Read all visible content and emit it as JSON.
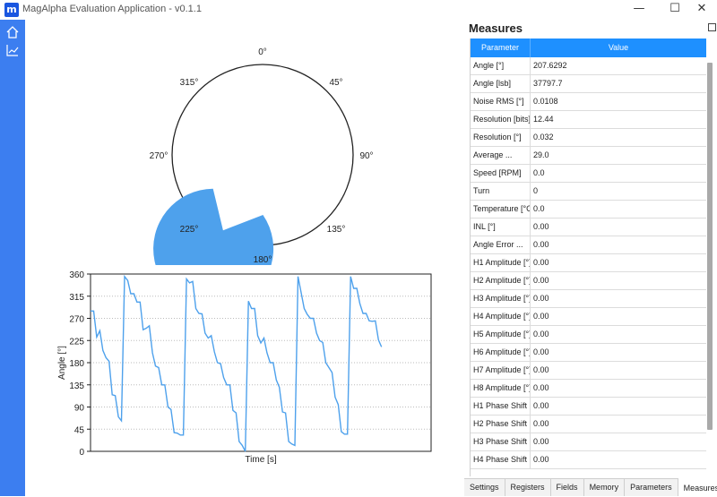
{
  "window": {
    "title": "MagAlpha Evaluation Application - v0.1.1",
    "icon_letter": "m",
    "minimize": "—",
    "maximize": "☐",
    "close": "✕"
  },
  "sidebar": {
    "items": [
      {
        "icon": "home-icon"
      },
      {
        "icon": "chart-icon"
      }
    ],
    "color": "#3c7ef0"
  },
  "gauge": {
    "value_text": "207.63°",
    "angle_deg": 207.63,
    "labels": [
      "0°",
      "45°",
      "90°",
      "135°",
      "180°",
      "225°",
      "270°",
      "315°"
    ],
    "accent": "#4ea1ec"
  },
  "chart_data": {
    "type": "line",
    "xlabel": "Time [s]",
    "ylabel": "Angle [°]",
    "ylim": [
      0,
      360
    ],
    "yticks": [
      0,
      45,
      90,
      135,
      180,
      225,
      270,
      315,
      360
    ],
    "grid": "horizontal dotted",
    "color": "#4ea1ec",
    "x": [
      0,
      1,
      2,
      3,
      4,
      5,
      6,
      7,
      8,
      9,
      10,
      11,
      12,
      13,
      14,
      15,
      16,
      17,
      18,
      19,
      20,
      21,
      22,
      23,
      24,
      25,
      26,
      27,
      28,
      29,
      30,
      31,
      32,
      33,
      34,
      35,
      36,
      37,
      38,
      39,
      40,
      41,
      42,
      43,
      44,
      45,
      46,
      47,
      48,
      49,
      50,
      51,
      52,
      53,
      54,
      55,
      56,
      57,
      58,
      59,
      60,
      61,
      62,
      63,
      64,
      65,
      66,
      67,
      68,
      69,
      70,
      71,
      72,
      73,
      74,
      75,
      76,
      77,
      78,
      79,
      80,
      81,
      82,
      83,
      84,
      85,
      86,
      87,
      88,
      89,
      90,
      91,
      92,
      93,
      94,
      95,
      96,
      97,
      98,
      99,
      100,
      101,
      102,
      103,
      104,
      105,
      106,
      107,
      108,
      109,
      110
    ],
    "y": [
      285,
      285,
      232,
      245,
      205,
      190,
      183,
      115,
      113,
      70,
      62,
      355,
      347,
      320,
      320,
      303,
      303,
      247,
      250,
      255,
      200,
      173,
      170,
      135,
      135,
      90,
      85,
      38,
      37,
      33,
      33,
      350,
      342,
      345,
      290,
      280,
      279,
      240,
      230,
      235,
      202,
      180,
      178,
      150,
      135,
      135,
      83,
      78,
      20,
      12,
      0,
      305,
      290,
      290,
      235,
      220,
      230,
      200,
      180,
      180,
      145,
      130,
      80,
      78,
      20,
      15,
      12,
      355,
      323,
      290,
      278,
      270,
      270,
      240,
      225,
      221,
      180,
      170,
      160,
      110,
      95,
      40,
      35,
      35,
      355,
      331,
      331,
      300,
      280,
      280,
      265,
      264,
      265,
      226,
      212
    ]
  },
  "measures": {
    "title": "Measures",
    "headers": [
      "Parameter",
      "Value"
    ],
    "rows": [
      {
        "param": "Angle [°]",
        "value": "207.6292"
      },
      {
        "param": "Angle [lsb]",
        "value": "37797.7"
      },
      {
        "param": "Noise RMS [°]",
        "value": "0.0108"
      },
      {
        "param": "Resolution [bits]",
        "value": "12.44"
      },
      {
        "param": "Resolution [°]",
        "value": "0.032"
      },
      {
        "param": "Average ...",
        "value": "29.0"
      },
      {
        "param": "Speed [RPM]",
        "value": "0.0"
      },
      {
        "param": "Turn",
        "value": "0"
      },
      {
        "param": "Temperature [°C]",
        "value": "0.0"
      },
      {
        "param": "INL [°]",
        "value": "0.00"
      },
      {
        "param": "Angle Error ...",
        "value": "0.00"
      },
      {
        "param": "H1 Amplitude [°]",
        "value": "0.00"
      },
      {
        "param": "H2 Amplitude [°]",
        "value": "0.00"
      },
      {
        "param": "H3 Amplitude [°]",
        "value": "0.00"
      },
      {
        "param": "H4 Amplitude [°]",
        "value": "0.00"
      },
      {
        "param": "H5 Amplitude [°]",
        "value": "0.00"
      },
      {
        "param": "H6 Amplitude [°]",
        "value": "0.00"
      },
      {
        "param": "H7 Amplitude [°]",
        "value": "0.00"
      },
      {
        "param": "H8 Amplitude [°]",
        "value": "0.00"
      },
      {
        "param": "H1 Phase Shift [°]",
        "value": "0.00"
      },
      {
        "param": "H2 Phase Shift [°]",
        "value": "0.00"
      },
      {
        "param": "H3 Phase Shift [°]",
        "value": "0.00"
      },
      {
        "param": "H4 Phase Shift [°]",
        "value": "0.00"
      }
    ]
  },
  "tabs": [
    {
      "label": "Settings",
      "active": false
    },
    {
      "label": "Registers",
      "active": false
    },
    {
      "label": "Fields",
      "active": false
    },
    {
      "label": "Memory",
      "active": false
    },
    {
      "label": "Parameters",
      "active": false
    },
    {
      "label": "Measures",
      "active": true
    }
  ]
}
